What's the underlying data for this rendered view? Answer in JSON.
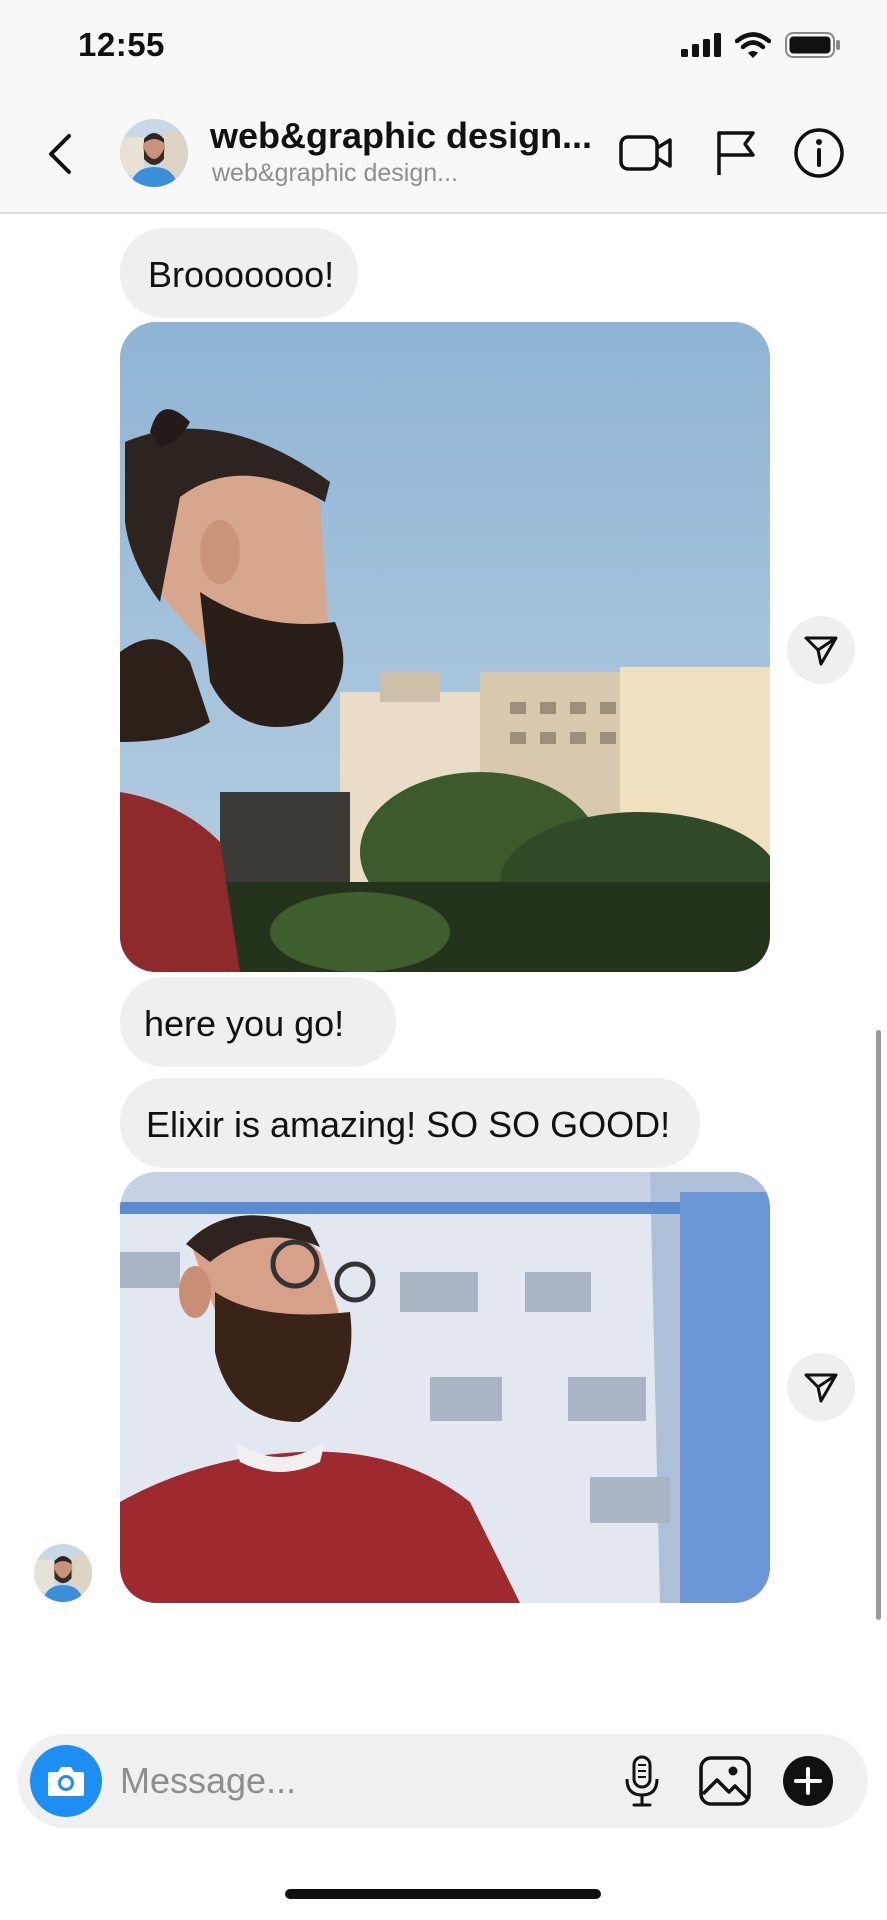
{
  "status_bar": {
    "time": "12:55"
  },
  "header": {
    "title": "web&graphic design...",
    "subtitle": "web&graphic design..."
  },
  "messages": [
    {
      "type": "text",
      "text": "Brooooooo!"
    },
    {
      "type": "image",
      "subject": "bearded man with top knot in profile, city buildings behind"
    },
    {
      "type": "text",
      "text": "here you go!"
    },
    {
      "type": "text",
      "text": "Elixir is amazing! SO SO GOOD!"
    },
    {
      "type": "image",
      "subject": "bearded man in sunglasses, blue-white office building behind"
    }
  ],
  "composer": {
    "placeholder": "Message..."
  },
  "colors": {
    "accent": "#1d8ff2",
    "bubble": "#efefef",
    "header_bg": "#f8f8f8"
  },
  "icons": [
    "back-chevron-icon",
    "video-call-icon",
    "flag-icon",
    "info-icon",
    "share-send-icon",
    "camera-icon",
    "microphone-icon",
    "gallery-icon",
    "plus-icon"
  ]
}
